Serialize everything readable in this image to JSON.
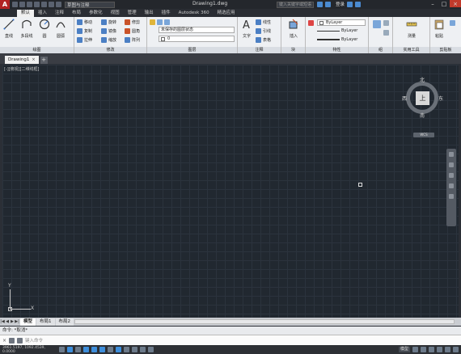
{
  "app": {
    "logo": "A",
    "doc_title": "Drawing1.dwg",
    "workspace": "草图与注释",
    "search_placeholder": "键入关键字或短语",
    "login": "登录"
  },
  "ribbon_tabs": [
    "默认",
    "插入",
    "注释",
    "布局",
    "参数化",
    "视图",
    "管理",
    "输出",
    "插件",
    "Autodesk 360",
    "精选应用"
  ],
  "ribbon": {
    "draw": {
      "title": "绘图",
      "line": "直线",
      "polyline": "多段线",
      "circle": "圆",
      "arc": "圆弧"
    },
    "modify": {
      "title": "修改",
      "move": "移动",
      "rotate": "旋转",
      "trim": "修剪",
      "copy": "复制",
      "mirror": "镜像",
      "fillet": "圆角",
      "stretch": "拉伸",
      "scale": "缩放",
      "array": "阵列"
    },
    "layers": {
      "title": "图层",
      "layer_state": "未保存的图层状态",
      "current_layer": "0"
    },
    "annotation": {
      "title": "注释",
      "text": "文字",
      "linear": "线性",
      "leader": "引线",
      "table": "表格"
    },
    "block": {
      "title": "块",
      "insert": "插入"
    },
    "properties": {
      "title": "特性",
      "color": "ByLayer",
      "linetype": "ByLayer",
      "lineweight": "ByLayer"
    },
    "groups": {
      "title": "组"
    },
    "utilities": {
      "title": "实用工具",
      "measure": "测量"
    },
    "clipboard": {
      "title": "剪贴板",
      "paste": "粘贴"
    }
  },
  "doc_tab": {
    "label": "Drawing1",
    "close": "×",
    "add": "+"
  },
  "viewport_label": "[-][俯视][二维线框]",
  "viewcube": {
    "north": "北",
    "south": "南",
    "west": "西",
    "east": "东",
    "face": "上",
    "wcs": "WCS"
  },
  "ucs": {
    "x": "X",
    "y": "Y"
  },
  "layout_tabs": [
    "模型",
    "布局1",
    "布局2"
  ],
  "command": {
    "history": "命令: *取消*",
    "placeholder": "键入命令",
    "close": "×"
  },
  "status": {
    "coords": "3961.5197, 1092.4539, 0.0000",
    "model": "模型"
  }
}
